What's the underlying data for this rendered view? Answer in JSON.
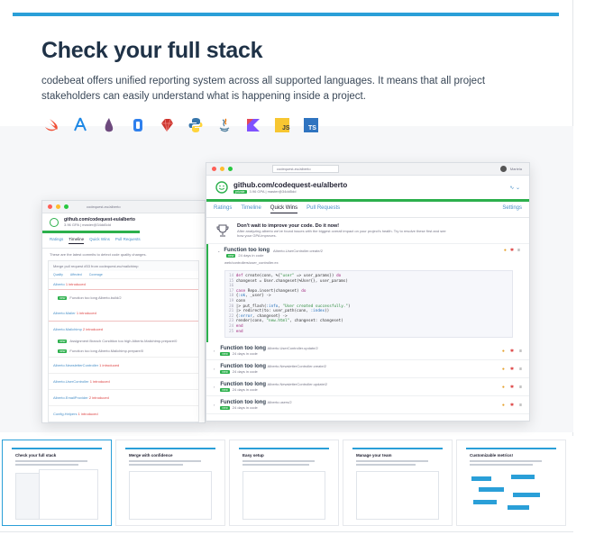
{
  "heading": "Check your full stack",
  "description": "codebeat offers unified reporting system across all supported languages. It means that all project stakeholders can easily understand what is happening inside a project.",
  "languages": [
    "swift-icon",
    "appstore-icon",
    "elixir-icon",
    "objc-icon",
    "ruby-icon",
    "python-icon",
    "java-icon",
    "kotlin-icon",
    "js-icon",
    "ts-icon"
  ],
  "lang_labels": {
    "js": "JS",
    "ts": "TS"
  },
  "front": {
    "branch": "codequest-eu/alberto",
    "user": "Mariela",
    "repo": "github.com/codequest-eu/alberto",
    "meta": "3.96 GPA | master@34dd5dd",
    "tabs": [
      "Ratings",
      "Timeline",
      "Quick Wins",
      "Pull Requests"
    ],
    "settings": "Settings",
    "promo_title": "Don't wait to improve your code. Do it now!",
    "promo_text": "After analyzing alberto we've found issues with the biggest overall impact on your project's health. Try to resolve these first and see how your GPA improves.",
    "issues": [
      {
        "title": "Function too long",
        "path": "Alberto.UserController.create/2",
        "age": "24 days in code"
      },
      {
        "title": "Function too long",
        "path": "Alberto.UserController.update/2",
        "age": "24 days in code"
      },
      {
        "title": "Function too long",
        "path": "Alberto.NewsletterController.create/2",
        "age": "24 days in code"
      },
      {
        "title": "Function too long",
        "path": "Alberto.NewsletterController.update/2",
        "age": "24 days in code"
      },
      {
        "title": "Function too long",
        "path": "Alberto.users/2",
        "age": "24 days in code"
      }
    ],
    "file": "web/controllers/user_controller.ex"
  },
  "back": {
    "branch": "codequest-eu/alberto",
    "repo": "github.com/codequest-eu/alberto",
    "meta": "3.96 GPA | master@34dd5dd",
    "tabs": [
      "Ratings",
      "Timeline",
      "Quick Wins",
      "Pull Requests"
    ],
    "notice": "These are the latest commits to detect code quality changes.",
    "merge": "Merge pull request #53 from codequest-eu/mailchimp",
    "subtabs": [
      "Quality",
      "Affected",
      "Coverage"
    ],
    "rows": [
      {
        "name": "Alberto",
        "count": "1 introduced"
      },
      {
        "name": "Function too long",
        "path": "Alberto.build/2"
      },
      {
        "name": "Alberto.Mailer",
        "count": "1 introduced"
      },
      {
        "name": "Alberto.Mailchimp",
        "count": "2 introduced"
      },
      {
        "name": "Assignment Branch Condition too high",
        "path": "Alberto.Mailchimp.prepare/0"
      },
      {
        "name": "Function too long",
        "path": "Alberto.Mailchimp.prepare/0"
      },
      {
        "name": "Alberto.NewsletterController",
        "count": "1 introduced"
      },
      {
        "name": "Alberto.UserController",
        "count": "1 introduced"
      },
      {
        "name": "Alberto.EmailProvider",
        "count": "2 introduced"
      },
      {
        "name": "Config.Helpers",
        "count": "1 introduced"
      }
    ]
  },
  "thumbs": [
    {
      "title": "Check your full stack"
    },
    {
      "title": "Merge with confidence"
    },
    {
      "title": "Easy setup"
    },
    {
      "title": "Manage your team"
    },
    {
      "title": "Customizable metrics!"
    }
  ],
  "colors": {
    "accent": "#2a9fd8",
    "green": "#2cb04c",
    "heading": "#1f3247"
  }
}
